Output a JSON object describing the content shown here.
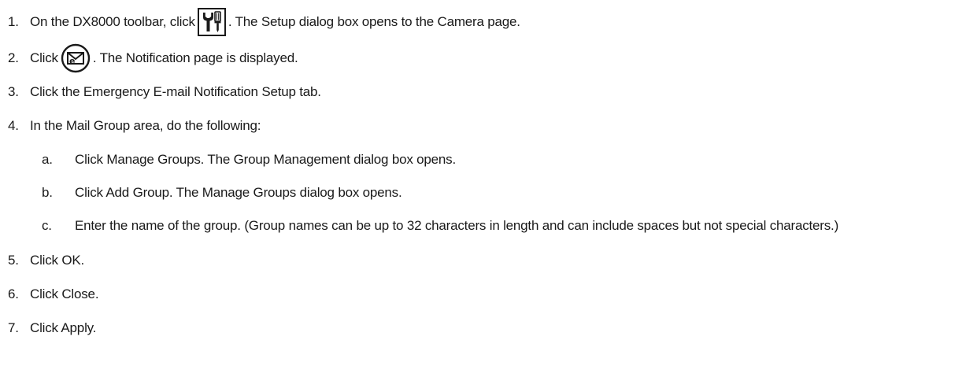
{
  "icons": {
    "tools": "wrench-screwdriver-icon",
    "mail": "envelope-e-icon"
  },
  "steps": [
    {
      "num": "1.",
      "before": "On the DX8000 toolbar, click",
      "after": ". The Setup dialog box opens to the Camera page."
    },
    {
      "num": "2.",
      "before": "Click",
      "after": ". The Notification page is displayed."
    },
    {
      "num": "3.",
      "text": "Click the Emergency E-mail Notification Setup tab."
    },
    {
      "num": "4.",
      "text": "In the Mail Group area, do the following:"
    },
    {
      "num": "5.",
      "text": "Click OK."
    },
    {
      "num": "6.",
      "text": "Click Close."
    },
    {
      "num": "7.",
      "text": "Click Apply."
    }
  ],
  "substeps": [
    {
      "letter": "a.",
      "text": "Click Manage Groups. The Group Management dialog box opens."
    },
    {
      "letter": "b.",
      "text": "Click Add Group. The Manage Groups dialog box opens."
    },
    {
      "letter": "c.",
      "text": "Enter the name of the group. (Group names can be up to 32 characters in length and can include spaces but not special characters.)"
    }
  ]
}
